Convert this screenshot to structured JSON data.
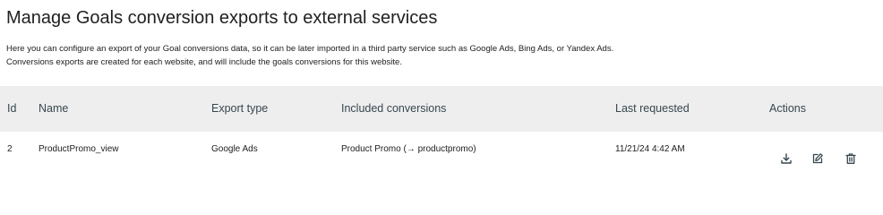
{
  "page": {
    "title": "Manage Goals conversion exports to external services",
    "description_line1": "Here you can configure an export of your Goal conversions data, so it can be later imported in a third party service such as Google Ads, Bing Ads, or Yandex Ads.",
    "description_line2": "Conversions exports are created for each website, and will include the goals conversions for this website."
  },
  "table": {
    "headers": {
      "id": "Id",
      "name": "Name",
      "export_type": "Export type",
      "included_conversions": "Included conversions",
      "last_requested": "Last requested",
      "actions": "Actions"
    },
    "rows": [
      {
        "id": "2",
        "name": "ProductPromo_view",
        "export_type": "Google Ads",
        "included_conversions": "Product Promo (→ productpromo)",
        "last_requested": "11/21/24 4:42 AM",
        "actions": [
          "download-icon",
          "edit-icon",
          "delete-icon"
        ]
      }
    ]
  }
}
